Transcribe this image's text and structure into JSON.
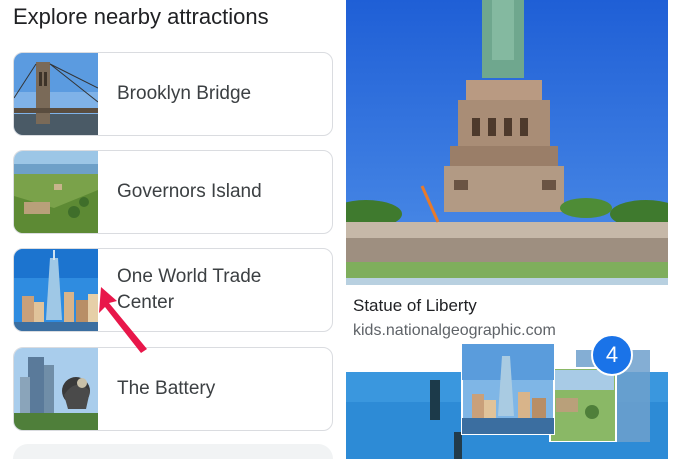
{
  "left": {
    "title": "Explore nearby attractions",
    "cards": [
      {
        "label": "Brooklyn Bridge",
        "thumb": "brooklyn-bridge-photo"
      },
      {
        "label": "Governors Island",
        "thumb": "governors-island-photo"
      },
      {
        "label": "One World Trade Center",
        "thumb": "one-world-trade-center-photo"
      },
      {
        "label": "The Battery",
        "thumb": "the-battery-photo"
      }
    ]
  },
  "right": {
    "hero_title": "Statue of Liberty",
    "hero_source": "kids.nationalgeographic.com"
  },
  "drag": {
    "count": "4"
  },
  "colors": {
    "badge": "#1a73e8",
    "pointer": "#e8174a"
  }
}
